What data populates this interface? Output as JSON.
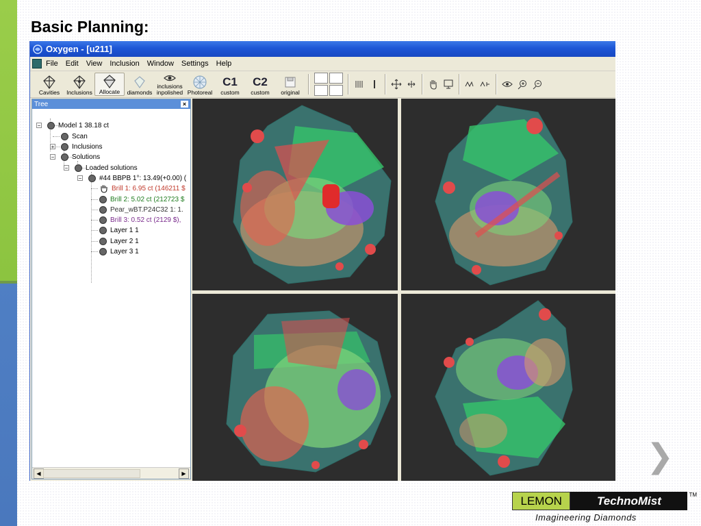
{
  "slide": {
    "title": "Basic Planning:",
    "next_arrow": "❯"
  },
  "window": {
    "title": "Oxygen - [u211]"
  },
  "menu": [
    "File",
    "Edit",
    "View",
    "Inclusion",
    "Window",
    "Settings",
    "Help"
  ],
  "toolbar": {
    "cavities": "Cavities",
    "inclusions": "Inclusions",
    "allocate": "Allocate",
    "diamonds": "diamonds",
    "inclusions_inpolished_1": "inclusions",
    "inclusions_inpolished_2": "inpolished",
    "photoreal": "Photoreal",
    "c1": "C1",
    "c1_label": "custom",
    "c2": "C2",
    "c2_label": "custom",
    "original": "original"
  },
  "tree": {
    "header": "Tree",
    "close": "×",
    "model": "Model 1 38.18 ct",
    "scan": "Scan",
    "inclusions": "Inclusions",
    "solutions": "Solutions",
    "loaded": "Loaded solutions",
    "solution": "#44 BBPB 1°: 13.49(+0.00) (",
    "brill1": "Brill 1: 6.95 ct (146211 $",
    "brill2": "Brill 2: 5.02 ct (212723 $",
    "pear": "Pear_wBT.P24C32 1: 1.",
    "brill3": "Brill 3: 0.52 ct (2129 $),",
    "layer1": "Layer 1 1",
    "layer2": "Layer 2 1",
    "layer3": "Layer 3 1",
    "colors": {
      "brill1": "#c0392b",
      "brill2": "#1e7b1e",
      "pear": "#333333",
      "brill3": "#7a2b8c"
    }
  },
  "logo": {
    "lemon": "LEMON",
    "techno": "TechnoMist",
    "tm": "TM",
    "tagline": "Imagineering  Diamonds"
  }
}
